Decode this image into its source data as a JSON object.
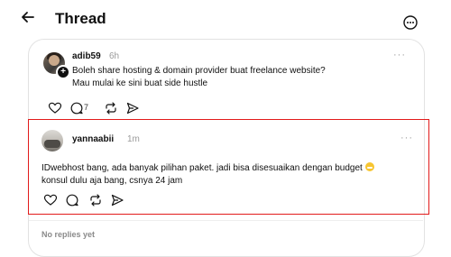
{
  "header": {
    "title": "Thread"
  },
  "post": {
    "username": "adib59",
    "time": "6h",
    "more": "···",
    "lines": [
      "Boleh share hosting & domain provider buat freelance website?",
      "Mau mulai ke sini buat side hustle"
    ],
    "reply_count": "7",
    "follow_badge": "+"
  },
  "reply": {
    "username": "yannaabii",
    "time": "1m",
    "more": "···",
    "lines": [
      "IDwebhost bang, ada banyak pilihan paket. jadi bisa disesuaikan dengan budget",
      "konsul dulu aja bang, csnya 24 jam"
    ]
  },
  "footer": {
    "no_replies": "No replies yet"
  },
  "colors": {
    "highlight": "#e21b1b",
    "text": "#101010",
    "muted": "#9a9a9a"
  }
}
